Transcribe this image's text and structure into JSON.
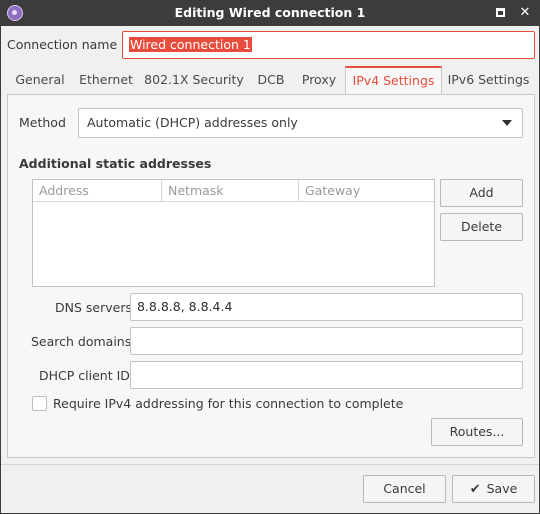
{
  "window": {
    "title": "Editing Wired connection 1",
    "maximize_label": "",
    "close_label": "✕"
  },
  "connection": {
    "name_label": "Connection name",
    "name_value": "Wired connection 1"
  },
  "tabs": [
    {
      "label": "General"
    },
    {
      "label": "Ethernet"
    },
    {
      "label": "802.1X Security"
    },
    {
      "label": "DCB"
    },
    {
      "label": "Proxy"
    },
    {
      "label": "IPv4 Settings"
    },
    {
      "label": "IPv6 Settings"
    }
  ],
  "active_tab": "IPv4 Settings",
  "ipv4": {
    "method_label": "Method",
    "method_value": "Automatic (DHCP) addresses only",
    "static_title": "Additional static addresses",
    "columns": [
      "Address",
      "Netmask",
      "Gateway"
    ],
    "rows": [],
    "add_label": "Add",
    "delete_label": "Delete",
    "dns_label": "DNS servers",
    "dns_value": "8.8.8.8, 8.8.4.4",
    "search_label": "Search domains",
    "search_value": "",
    "dhcp_label": "DHCP client ID",
    "dhcp_value": "",
    "require_label": "Require IPv4 addressing for this connection to complete",
    "require_checked": false,
    "routes_label": "Routes..."
  },
  "footer": {
    "cancel_label": "Cancel",
    "save_icon": "checkmark-icon",
    "save_label": "Save"
  },
  "colors": {
    "accent": "#e74c3c",
    "titlebar": "#3c3c3c"
  }
}
